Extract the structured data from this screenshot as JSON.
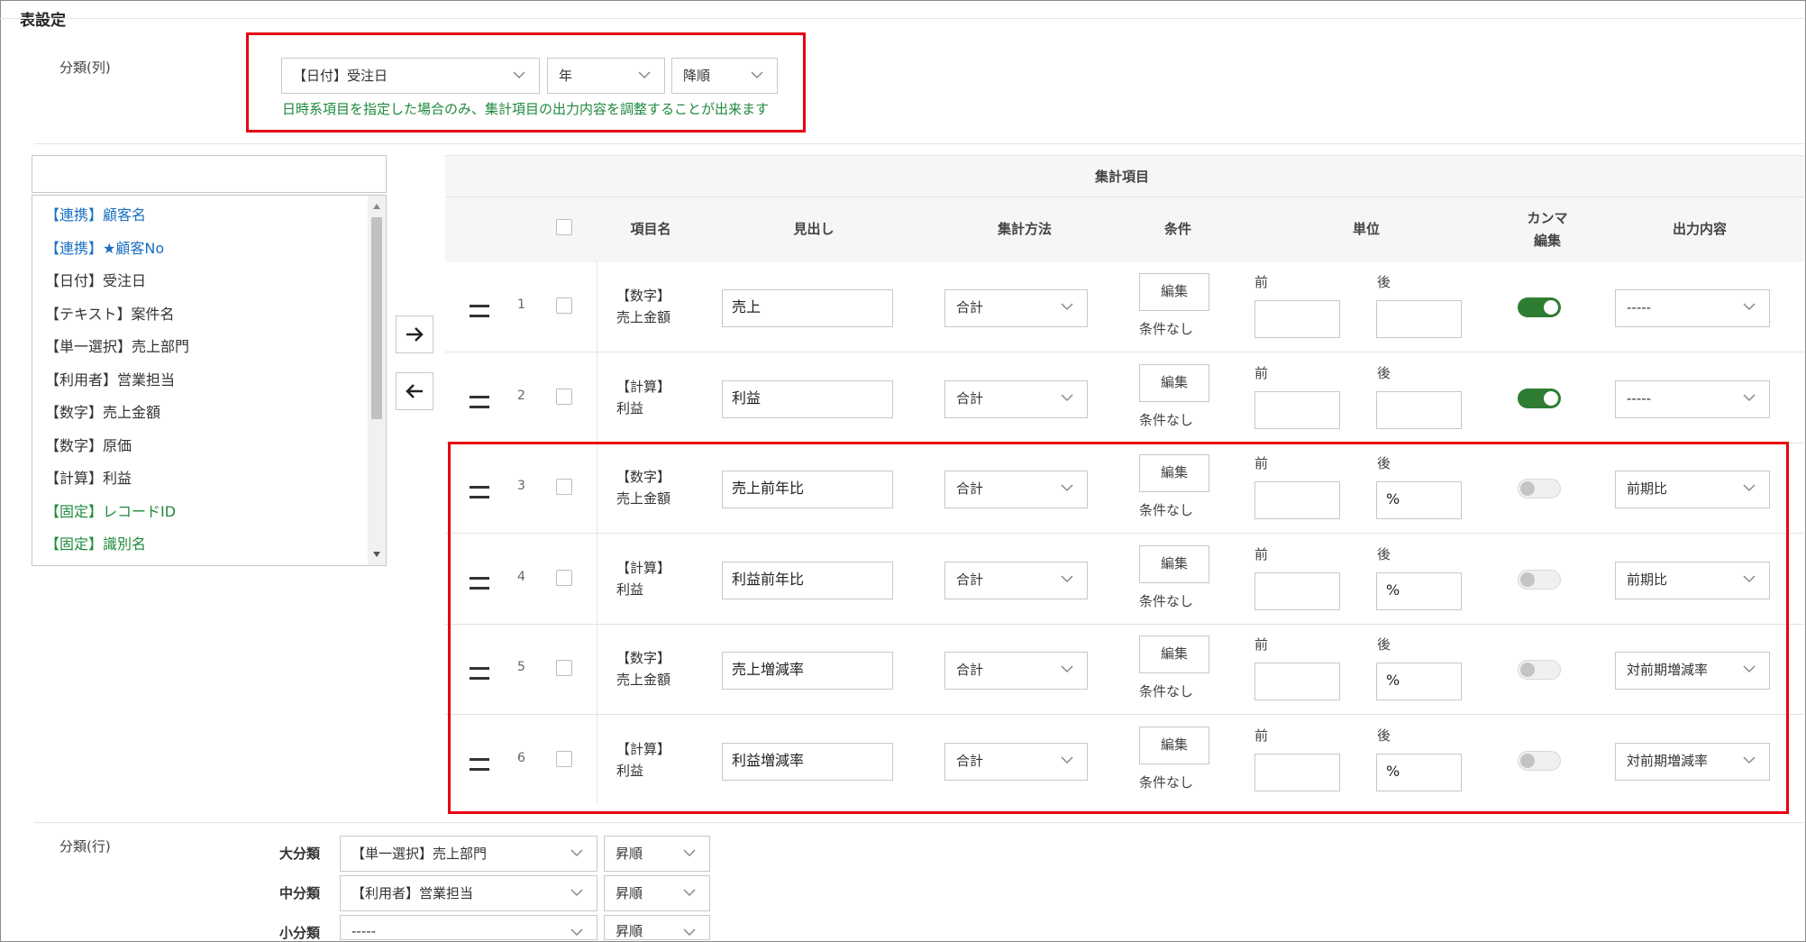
{
  "section_title": "表設定",
  "column_classification": {
    "label": "分類(列)",
    "field_select": "【日付】受注日",
    "unit_select": "年",
    "order_select": "降順",
    "note": "日時系項目を指定した場合のみ、集計項目の出力内容を調整することが出来ます"
  },
  "field_list": {
    "search_value": "",
    "items": [
      {
        "label": "【連携】顧客名",
        "color": "#1a6fc0"
      },
      {
        "label": "【連携】★顧客No",
        "color": "#1a6fc0"
      },
      {
        "label": "【日付】受注日",
        "color": "#333333"
      },
      {
        "label": "【テキスト】案件名",
        "color": "#333333"
      },
      {
        "label": "【単一選択】売上部門",
        "color": "#333333"
      },
      {
        "label": "【利用者】営業担当",
        "color": "#333333"
      },
      {
        "label": "【数字】売上金額",
        "color": "#333333"
      },
      {
        "label": "【数字】原価",
        "color": "#333333"
      },
      {
        "label": "【計算】利益",
        "color": "#333333"
      },
      {
        "label": "【固定】レコードID",
        "color": "#1e8a3c"
      },
      {
        "label": "【固定】識別名",
        "color": "#1e8a3c"
      }
    ]
  },
  "aggregate_table": {
    "title": "集計項目",
    "headers": {
      "item_name": "項目名",
      "heading": "見出し",
      "method": "集計方法",
      "condition": "条件",
      "unit": "単位",
      "comma_line1": "カンマ",
      "comma_line2": "編集",
      "output": "出力内容"
    },
    "edit_label": "編集",
    "no_condition": "条件なし",
    "before_label": "前",
    "after_label": "後",
    "rows": [
      {
        "num": "1",
        "type": "【数字】",
        "field": "売上金額",
        "heading": "売上",
        "method": "合計",
        "before": "",
        "after": "",
        "comma": true,
        "output": "-----"
      },
      {
        "num": "2",
        "type": "【計算】",
        "field": "利益",
        "heading": "利益",
        "method": "合計",
        "before": "",
        "after": "",
        "comma": true,
        "output": "-----"
      },
      {
        "num": "3",
        "type": "【数字】",
        "field": "売上金額",
        "heading": "売上前年比",
        "method": "合計",
        "before": "",
        "after": "%",
        "comma": false,
        "output": "前期比"
      },
      {
        "num": "4",
        "type": "【計算】",
        "field": "利益",
        "heading": "利益前年比",
        "method": "合計",
        "before": "",
        "after": "%",
        "comma": false,
        "output": "前期比"
      },
      {
        "num": "5",
        "type": "【数字】",
        "field": "売上金額",
        "heading": "売上増減率",
        "method": "合計",
        "before": "",
        "after": "%",
        "comma": false,
        "output": "対前期増減率"
      },
      {
        "num": "6",
        "type": "【計算】",
        "field": "利益",
        "heading": "利益増減率",
        "method": "合計",
        "before": "",
        "after": "%",
        "comma": false,
        "output": "対前期増減率"
      }
    ]
  },
  "row_classification": {
    "label": "分類(行)",
    "major_label": "大分類",
    "major_field": "【単一選択】売上部門",
    "major_order": "昇順",
    "middle_label": "中分類",
    "middle_field": "【利用者】営業担当",
    "middle_order": "昇順",
    "minor_label": "小分類",
    "minor_field": "-----",
    "minor_order": "昇順"
  },
  "colors": {
    "highlight": "#e60012",
    "toggle_on": "#2f7d32",
    "note_green": "#1e8a3c",
    "link_blue": "#1a6fc0"
  }
}
